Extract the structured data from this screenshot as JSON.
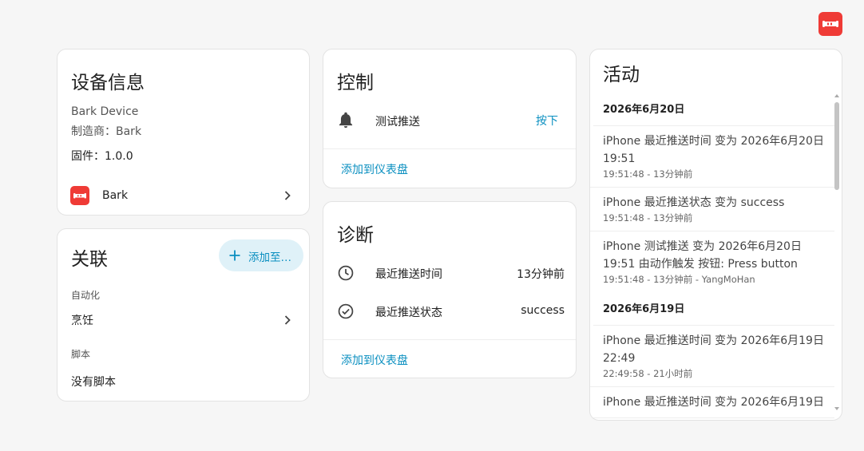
{
  "colors": {
    "accent": "#0a8fc0",
    "brand": "#ef3b36",
    "add_button_bg": "#dff1f8"
  },
  "device_info": {
    "title": "设备信息",
    "model": "Bark Device",
    "manufacturer": "制造商：Bark",
    "firmware": "固件：1.0.0",
    "integration_name": "Bark"
  },
  "related": {
    "title": "关联",
    "add_button_label": "添加至…",
    "automation_header": "自动化",
    "automation_item": "烹饪",
    "script_header": "脚本",
    "script_empty": "没有脚本"
  },
  "controls": {
    "title": "控制",
    "entity_name": "测试推送",
    "press_label": "按下",
    "add_to_dashboard": "添加到仪表盘"
  },
  "diagnostics": {
    "title": "诊断",
    "rows": [
      {
        "name": "最近推送时间",
        "value": "13分钟前",
        "icon": "clock-icon"
      },
      {
        "name": "最近推送状态",
        "value": "success",
        "icon": "check-circle-icon"
      }
    ],
    "add_to_dashboard": "添加到仪表盘"
  },
  "activity": {
    "title": "活动",
    "groups": [
      {
        "date": "2026年6月20日",
        "items": [
          {
            "message": "iPhone 最近推送时间 变为 2026年6月20日 19:51",
            "time": "19:51:48 - 13分钟前"
          },
          {
            "message": "iPhone 最近推送状态 变为 success",
            "time": "19:51:48 - 13分钟前"
          },
          {
            "message": "iPhone 测试推送 变为 2026年6月20日 19:51 由动作触发 按钮: Press button",
            "time": "19:51:48 - 13分钟前 - YangMoHan"
          }
        ]
      },
      {
        "date": "2026年6月19日",
        "items": [
          {
            "message": "iPhone 最近推送时间 变为 2026年6月19日 22:49",
            "time": "22:49:58 - 21小时前"
          },
          {
            "message": "iPhone 最近推送时间 变为 2026年6月19日",
            "time": ""
          }
        ]
      }
    ]
  }
}
